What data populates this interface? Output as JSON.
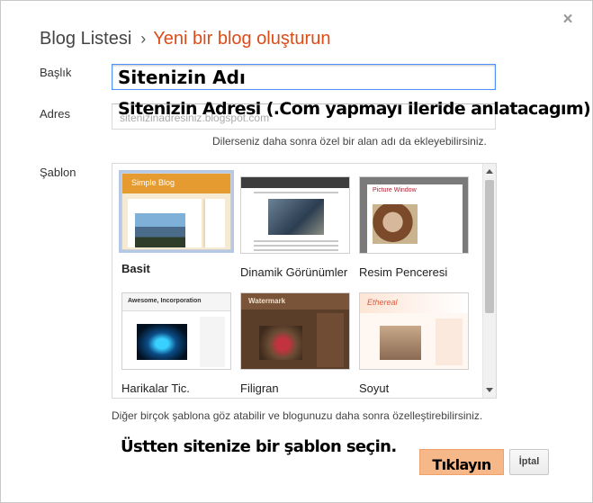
{
  "dialog": {
    "close_glyph": "×",
    "header": {
      "breadcrumb_root": "Blog Listesi",
      "separator": "›",
      "current": "Yeni bir blog oluşturun",
      "accent_color": "#dd4b17"
    },
    "title_field": {
      "label": "Başlık",
      "value": "Sitenizin Adı"
    },
    "address_field": {
      "label": "Adres",
      "placeholder": "sitenizinadresiniz.blogspot.com",
      "overlay_text": "Sitenizin Adresi (.Com yapmayı ileride anlatacagım)"
    },
    "address_hint": "Dilerseniz daha sonra özel bir alan adı da ekleyebilirsiniz.",
    "template_label": "Şablon",
    "templates": [
      {
        "name": "Basit",
        "preview_title": "Simple Blog",
        "selected": true
      },
      {
        "name": "Dinamik Görünümler",
        "selected": false
      },
      {
        "name": "Resim Penceresi",
        "preview_title": "Picture Window",
        "selected": false
      },
      {
        "name": "Harikalar Tic.",
        "preview_title": "Awesome, Incorporation",
        "selected": false
      },
      {
        "name": "Filigran",
        "preview_title": "Watermark",
        "selected": false
      },
      {
        "name": "Soyut",
        "preview_title": "Ethereal",
        "selected": false
      }
    ],
    "template_hint": "Diğer birçok şablona göz atabilir ve blogunuzu daha sonra özelleştirebilirsiniz.",
    "annotation": "Üstten sitenize bir şablon seçin.",
    "buttons": {
      "create": "Tıklayın",
      "cancel": "İptal"
    }
  }
}
